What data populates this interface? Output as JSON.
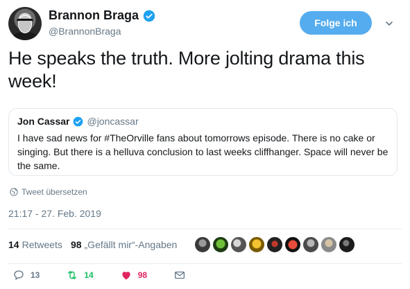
{
  "author": {
    "display_name": "Brannon Braga",
    "handle": "@BrannonBraga",
    "follow_label": "Folge ich"
  },
  "tweet": {
    "text": "He speaks the truth.  More jolting drama this week!"
  },
  "quoted_tweet": {
    "display_name": "Jon Cassar",
    "handle": "@joncassar",
    "text": "I have sad news for #TheOrville fans about tomorrows episode. There is no cake or singing. But there is a helluva conclusion to last weeks cliffhanger. Space will never be the same."
  },
  "translate_label": "Tweet übersetzen",
  "timestamp": "21:17 - 27. Feb. 2019",
  "stats": {
    "retweets_count": "14",
    "retweets_label": "Retweets",
    "likes_count": "98",
    "likes_label": "„Gefällt mir“-Angaben"
  },
  "liker_avatars": [
    "avatar-1",
    "avatar-2",
    "avatar-3",
    "avatar-4",
    "avatar-5",
    "avatar-6",
    "avatar-7",
    "avatar-8",
    "avatar-9"
  ],
  "actions": {
    "reply_count": "13",
    "retweet_count": "14",
    "like_count": "98"
  },
  "colors": {
    "accent": "#55acee",
    "verified": "#1da1f2",
    "retweet": "#17bf63",
    "like": "#e0245e",
    "muted": "#657786"
  }
}
